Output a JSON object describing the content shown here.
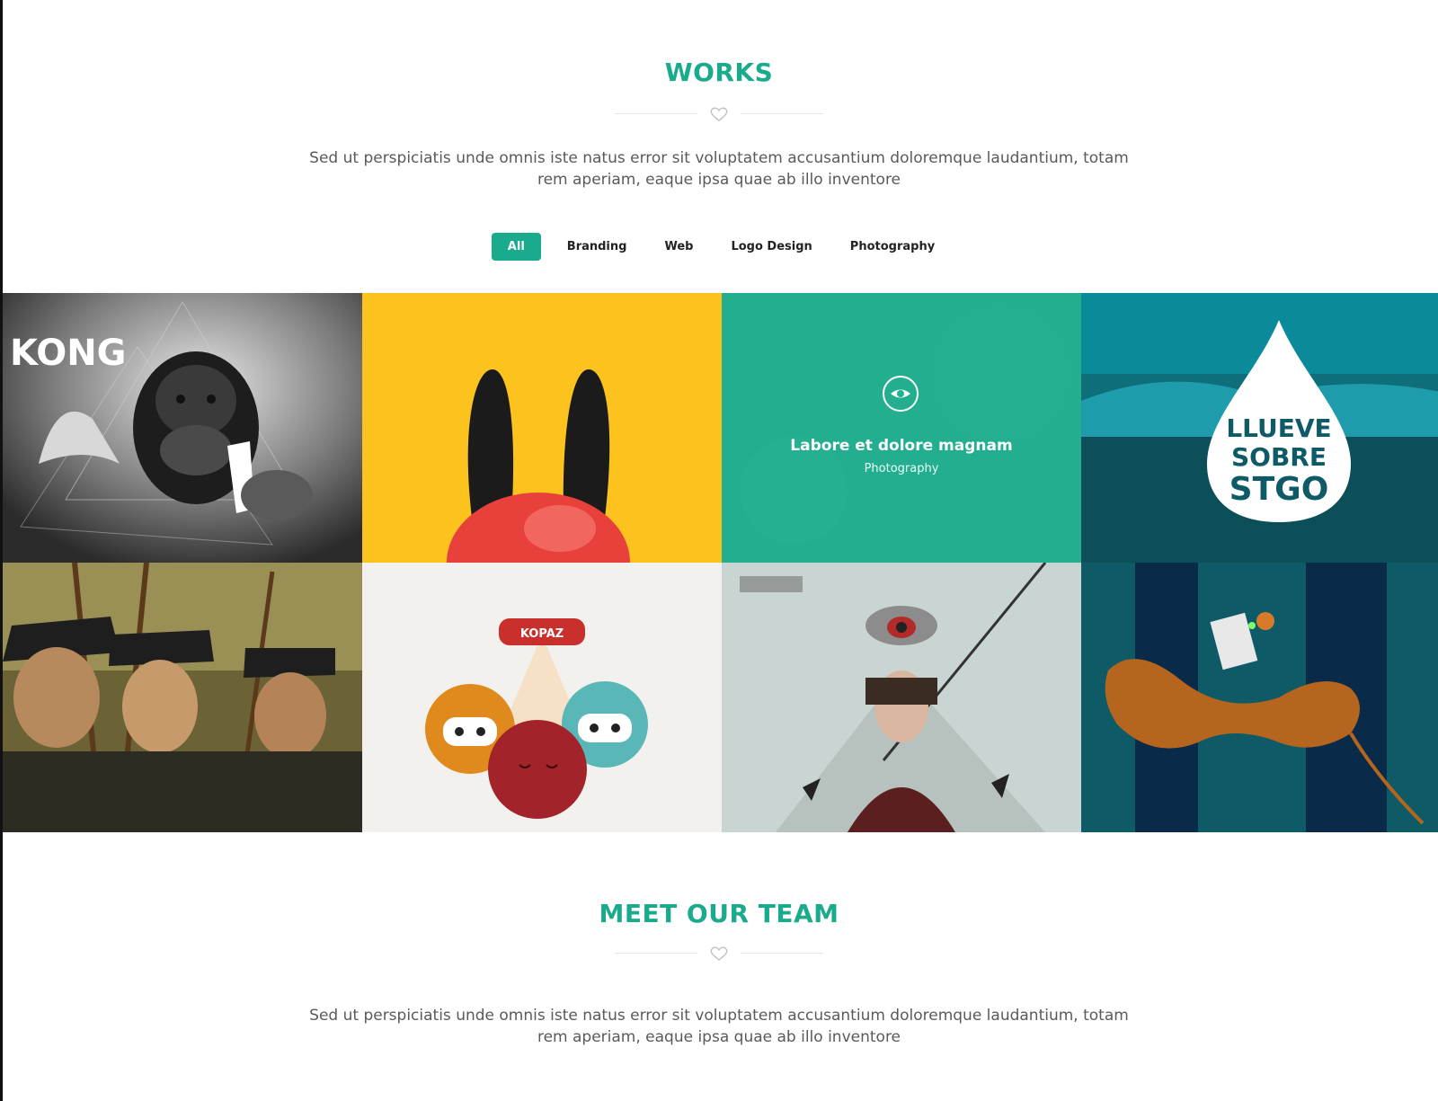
{
  "works": {
    "title": "WORKS",
    "description": "Sed ut perspiciatis unde omnis iste natus error sit voluptatem accusantium doloremque laudantium, totam rem aperiam, eaque ipsa quae ab illo inventore",
    "filters": [
      {
        "label": "All",
        "active": true
      },
      {
        "label": "Branding",
        "active": false
      },
      {
        "label": "Web",
        "active": false
      },
      {
        "label": "Logo Design",
        "active": false
      },
      {
        "label": "Photography",
        "active": false
      }
    ],
    "hover_item": {
      "title": "Labore et dolore magnam",
      "category": "Photography",
      "icon": "eye-icon"
    },
    "tiles": [
      {
        "subject": "kong",
        "text": "KONG"
      },
      {
        "subject": "rabbit-ears"
      },
      {
        "subject": "photography-hover"
      },
      {
        "subject": "drop",
        "text": [
          "LLUEVE",
          "SOBRE",
          "STGO"
        ]
      },
      {
        "subject": "soldiers"
      },
      {
        "subject": "monsters",
        "text": "KOPAZ"
      },
      {
        "subject": "surreal-portrait"
      },
      {
        "subject": "seahorse"
      }
    ]
  },
  "team": {
    "title": "MEET OUR TEAM",
    "description": "Sed ut perspiciatis unde omnis iste natus error sit voluptatem accusantium doloremque laudantium, totam rem aperiam, eaque ipsa quae ab illo inventore"
  },
  "colors": {
    "accent": "#1aaa8c",
    "text": "#5a5a5a",
    "filter_text": "#222222"
  }
}
